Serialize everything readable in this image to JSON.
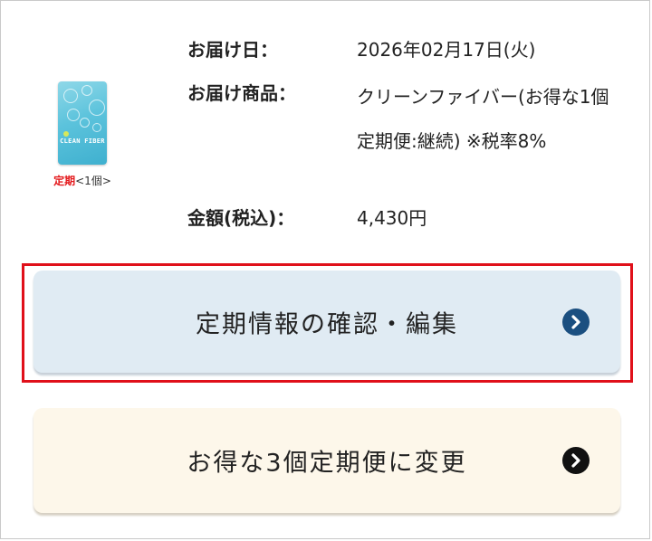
{
  "product": {
    "brand_text": "CLEAN FIBER",
    "tag": "定期",
    "qty": "<1個>"
  },
  "info": {
    "date_label": "お届け日：",
    "date_value": "2026年02月17日(火)",
    "product_label": "お届け商品：",
    "product_value": "クリーンファイバー(お得な1個定期便:継続) ※税率8%",
    "price_label": "金額(税込)：",
    "price_value": "4,430円"
  },
  "actions": {
    "edit_label": "定期情報の確認・編集",
    "change_label": "お得な3個定期便に変更"
  },
  "colors": {
    "highlight": "#e0101a",
    "edit_button_bg": "#e0ebf3",
    "edit_arrow": "#1b4f80",
    "change_button_bg": "#fdf7ea",
    "change_arrow": "#111111",
    "tag": "#e4191c"
  },
  "icons": {
    "edit_arrow": "chevron-right-circle-icon",
    "change_arrow": "chevron-right-circle-icon"
  }
}
